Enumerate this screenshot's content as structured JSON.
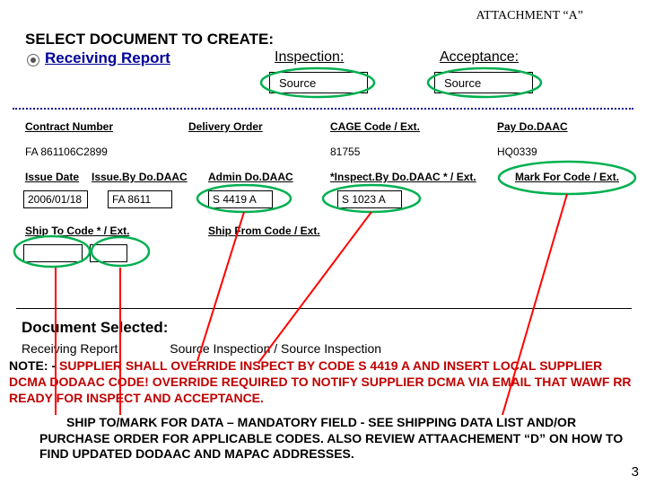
{
  "attachment_header": "ATTACHMENT “A”",
  "title": "SELECT DOCUMENT TO CREATE:",
  "sections": {
    "receiving_report_label": "Receiving Report",
    "inspection_label": "Inspection:",
    "acceptance_label": "Acceptance:",
    "inspection_value": "Source",
    "acceptance_value": "Source"
  },
  "fields": {
    "contract_number": {
      "label": "Contract Number",
      "value": "FA 861106C2899"
    },
    "delivery_order": {
      "label": "Delivery Order",
      "value": ""
    },
    "cage_code": {
      "label": "CAGE Code / Ext.",
      "value": "81755"
    },
    "pay_dodaac": {
      "label": "Pay Do.DAAC",
      "value": "HQ0339"
    },
    "issue_date": {
      "label": "Issue Date",
      "value": "2006/01/18"
    },
    "issue_by": {
      "label": "Issue.By Do.DAAC",
      "value": "FA 8611"
    },
    "admin": {
      "label": "Admin Do.DAAC",
      "value": "S 4419 A"
    },
    "inspect_by": {
      "label": "*Inspect.By Do.DAAC * / Ext.",
      "value": "S 1023 A"
    },
    "mark_for": {
      "label": "Mark For Code / Ext.",
      "value": ""
    },
    "ship_to": {
      "label": "Ship To Code * / Ext.",
      "value": ""
    },
    "ship_from": {
      "label": "Ship From Code / Ext.",
      "value": ""
    }
  },
  "document_selected": {
    "title": "Document Selected:",
    "report": "Receiving Report",
    "inspection": "Source Inspection / Source Inspection"
  },
  "notes": {
    "note1_intro": "NOTE: - ",
    "note1_body": "SUPPLIER SHALL OVERRIDE INSPECT BY CODE S 4419 A AND INSERT LOCAL SUPPLIER DCMA DODAAC CODE!  OVERRIDE REQUIRED TO NOTIFY SUPPLIER DCMA VIA EMAIL THAT WAWF RR READY FOR INSPECT AND ACCEPTANCE.",
    "note2": "SHIP TO/MARK FOR DATA – MANDATORY FIELD - SEE SHIPPING DATA LIST AND/OR PURCHASE ORDER FOR APPLICABLE CODES. ALSO REVIEW ATTAACHEMENT “D” ON HOW TO FIND UPDATED DODAAC AND MAPAC ADDRESSES."
  },
  "page_number": "3",
  "colors": {
    "link_blue": "#000099",
    "warning_red": "#c00000",
    "highlight_green": "#00b050"
  }
}
